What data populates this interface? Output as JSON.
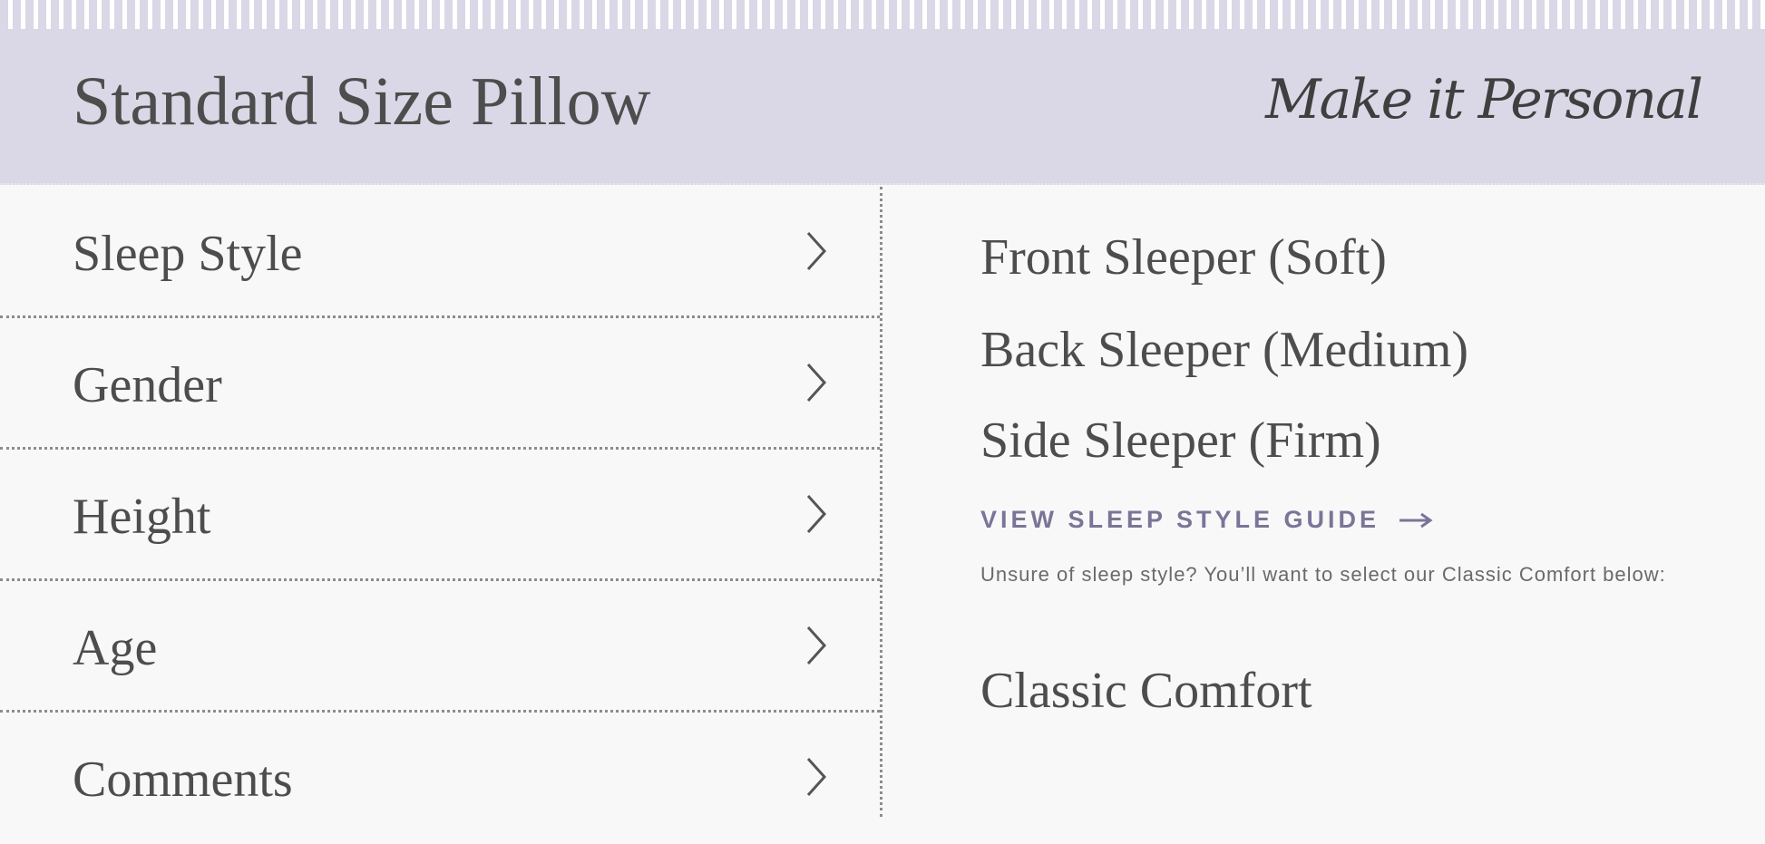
{
  "header": {
    "title": "Standard Size Pillow",
    "tagline": "Make it Personal"
  },
  "sidebar": {
    "items": [
      {
        "label": "Sleep Style"
      },
      {
        "label": "Gender"
      },
      {
        "label": "Height"
      },
      {
        "label": "Age"
      },
      {
        "label": "Comments"
      }
    ]
  },
  "panel": {
    "options": [
      {
        "label": "Front Sleeper (Soft)"
      },
      {
        "label": "Back Sleeper (Medium)"
      },
      {
        "label": "Side Sleeper (Firm)"
      }
    ],
    "guide_link": "VIEW SLEEP STYLE GUIDE",
    "hint": "Unsure of sleep style? You’ll want to select our Classic Comfort below:",
    "classic_option": "Classic Comfort"
  },
  "colors": {
    "header_bg": "#dad8e6",
    "page_bg": "#f8f8f8",
    "text": "#4d4d4d",
    "accent": "#7a7598"
  },
  "icons": {
    "chevron": "chevron-right-icon",
    "arrow": "arrow-right-icon"
  }
}
